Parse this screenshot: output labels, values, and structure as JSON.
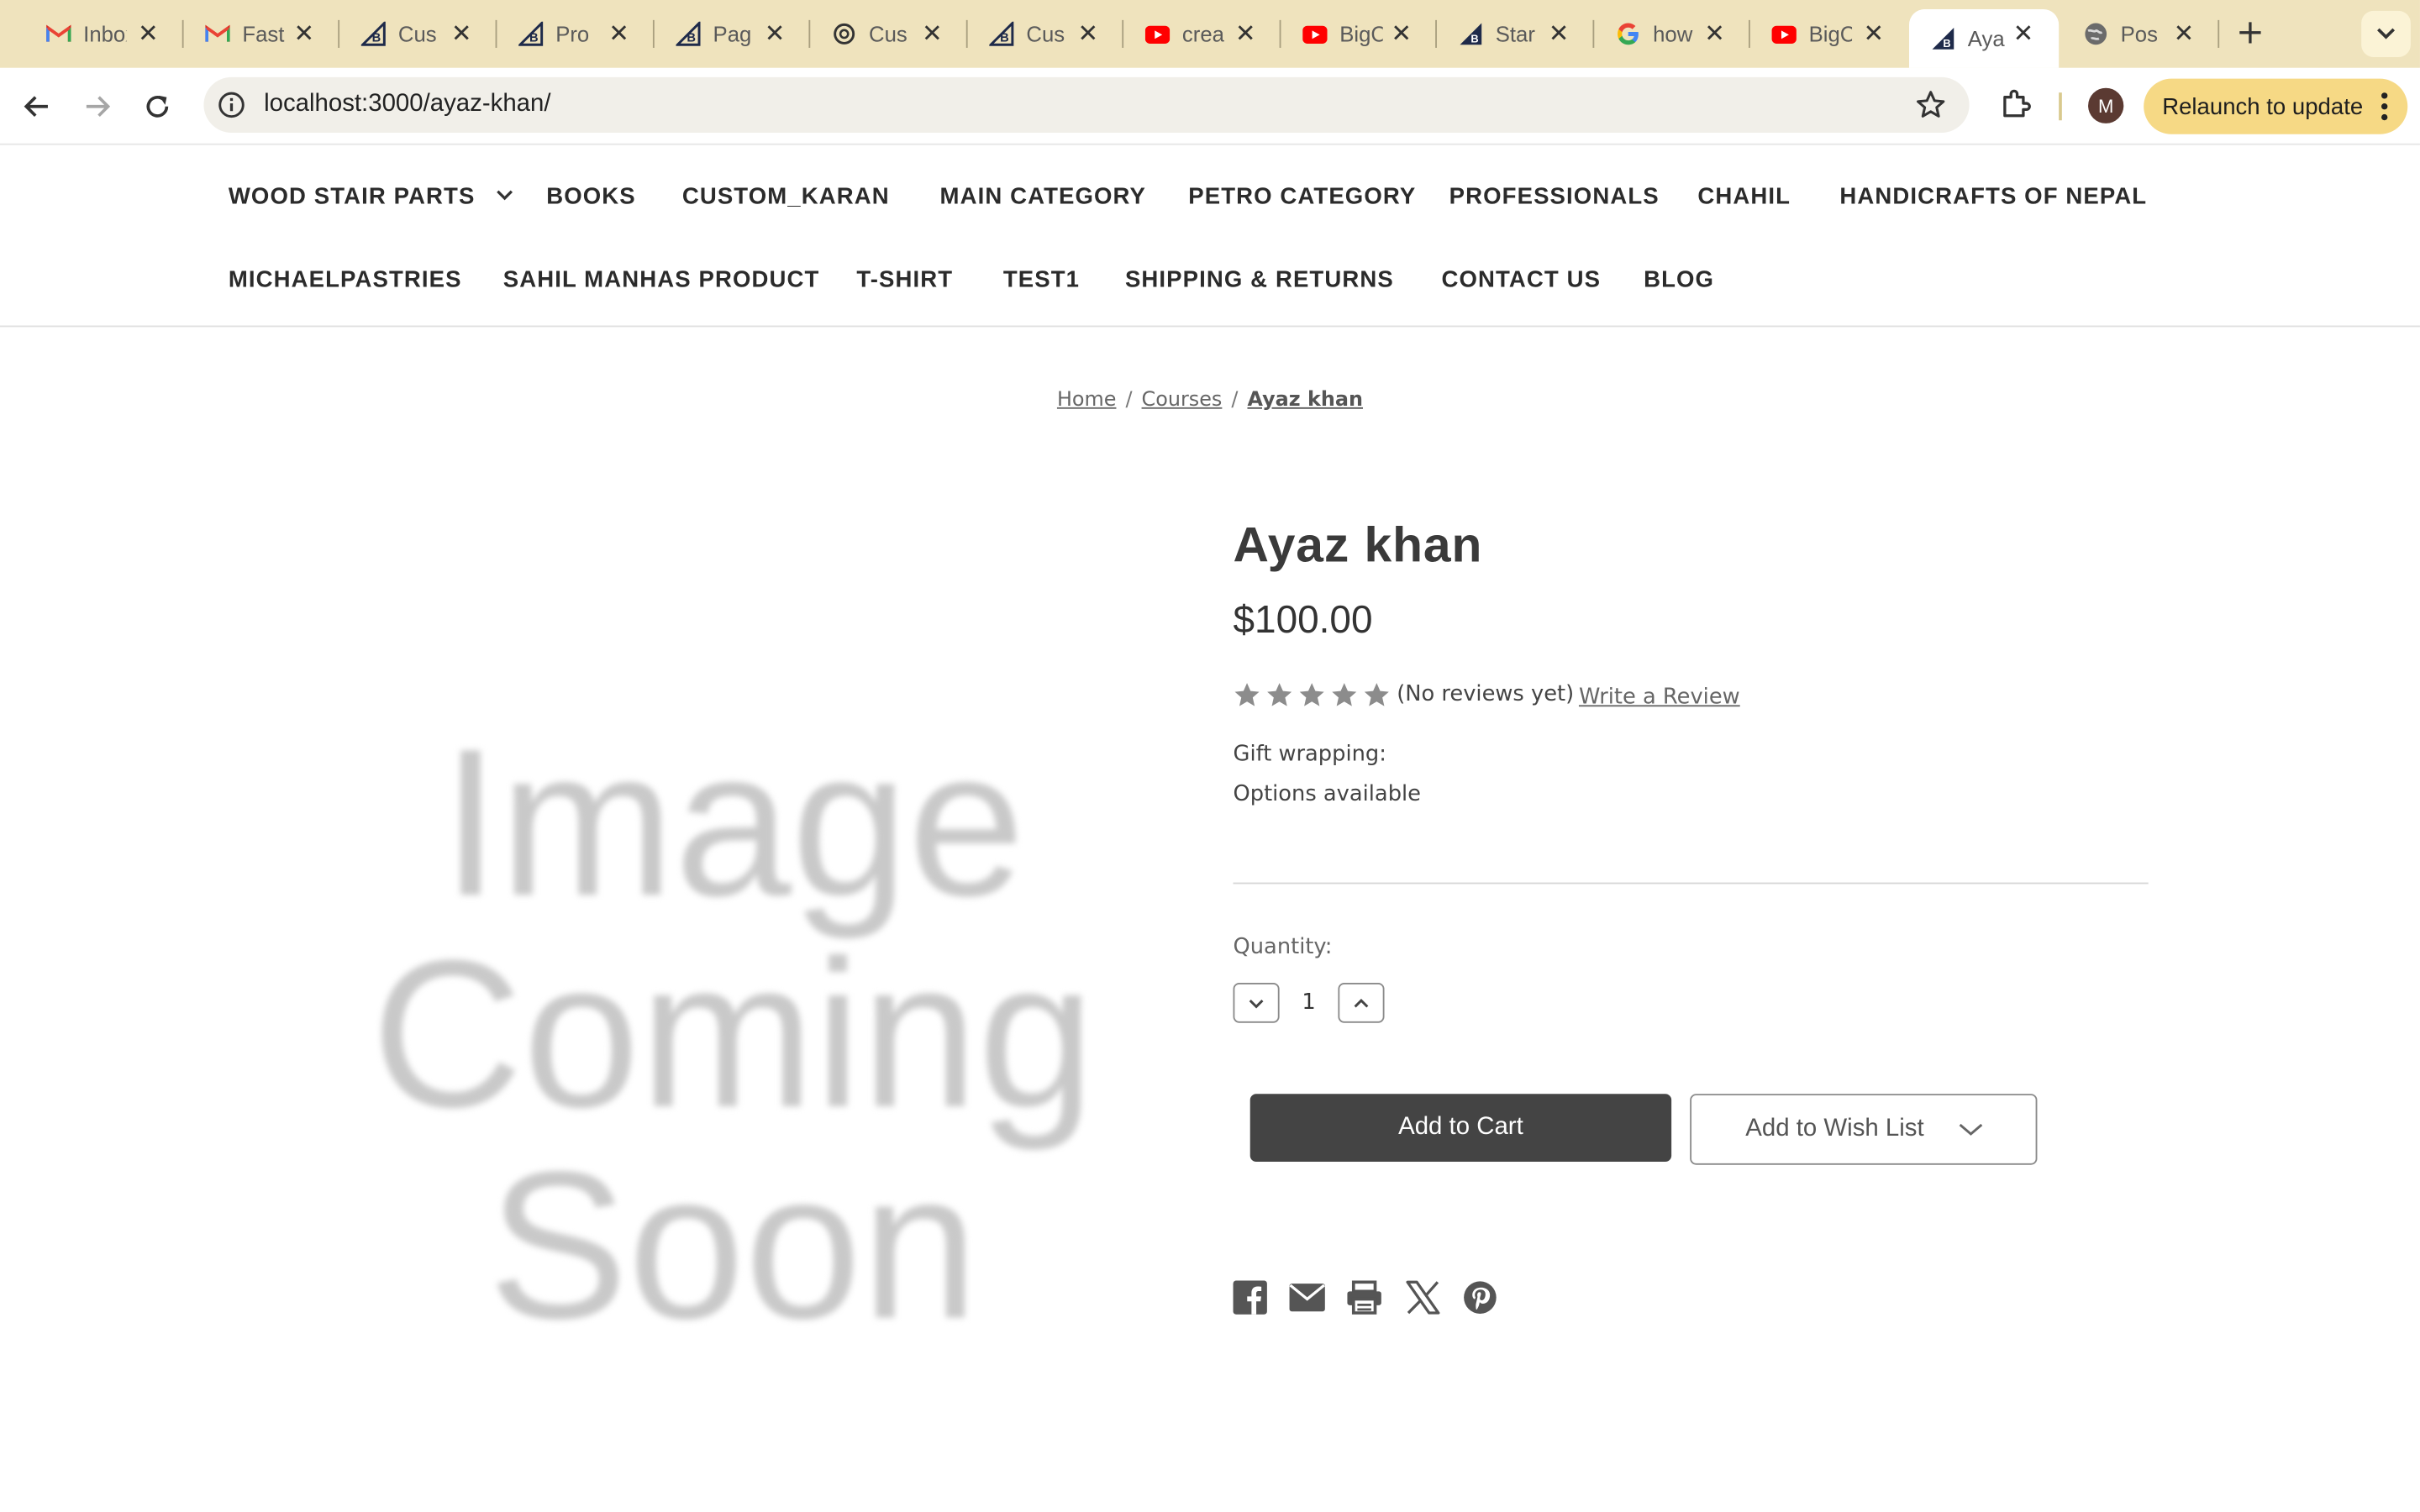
{
  "browser": {
    "tabs": [
      {
        "title": "Inbox",
        "icon": "gmail-icon"
      },
      {
        "title": "Fast",
        "icon": "gmail-icon"
      },
      {
        "title": "Cus",
        "icon": "bigcommerce-icon"
      },
      {
        "title": "Pro",
        "icon": "bigcommerce-icon"
      },
      {
        "title": "Pag",
        "icon": "bigcommerce-icon"
      },
      {
        "title": "Cus",
        "icon": "chatgpt-icon"
      },
      {
        "title": "Cus",
        "icon": "bigcommerce-icon"
      },
      {
        "title": "crea",
        "icon": "youtube-icon"
      },
      {
        "title": "BigC",
        "icon": "youtube-icon"
      },
      {
        "title": "Star",
        "icon": "bigcommerce-dark-icon"
      },
      {
        "title": "how",
        "icon": "google-icon"
      },
      {
        "title": "BigC",
        "icon": "youtube-icon"
      },
      {
        "title": "Aya",
        "icon": "bigcommerce-dark-icon",
        "active": true
      },
      {
        "title": "Pos",
        "icon": "globe-icon"
      }
    ],
    "url": "localhost:3000/ayaz-khan/",
    "profile_initial": "M",
    "relaunch_label": "Relaunch to update"
  },
  "nav": {
    "row1": [
      "WOOD STAIR PARTS",
      "BOOKS",
      "CUSTOM_KARAN",
      "MAIN CATEGORY",
      "PETRO CATEGORY",
      "PROFESSIONALS",
      "CHAHIL",
      "HANDICRAFTS OF NEPAL"
    ],
    "row2": [
      "MICHAELPASTRIES",
      "SAHIL MANHAS PRODUCT",
      "T-SHIRT",
      "TEST1",
      "SHIPPING & RETURNS",
      "CONTACT US",
      "BLOG"
    ]
  },
  "breadcrumb": [
    "Home",
    "Courses",
    "Ayaz khan"
  ],
  "placeholder_lines": [
    "Image",
    "Coming",
    "Soon"
  ],
  "product": {
    "title": "Ayaz khan",
    "price": "$100.00",
    "rating": 0,
    "rating_max": 5,
    "reviews_text": "(No reviews yet)",
    "write_review": "Write a Review",
    "gift_wrapping": "Gift wrapping:",
    "options": "Options available",
    "quantity_label": "Quantity:",
    "quantity": "1",
    "add_to_cart": "Add to Cart",
    "add_to_wishlist": "Add to Wish List"
  },
  "share_icons": [
    "facebook-icon",
    "email-icon",
    "print-icon",
    "x-icon",
    "pinterest-icon"
  ],
  "colors": {
    "tabstrip_bg": "#efe3bd",
    "relaunch_bg": "#f6d985",
    "cart_button": "#444444",
    "star_gray": "#8c8c8c"
  }
}
